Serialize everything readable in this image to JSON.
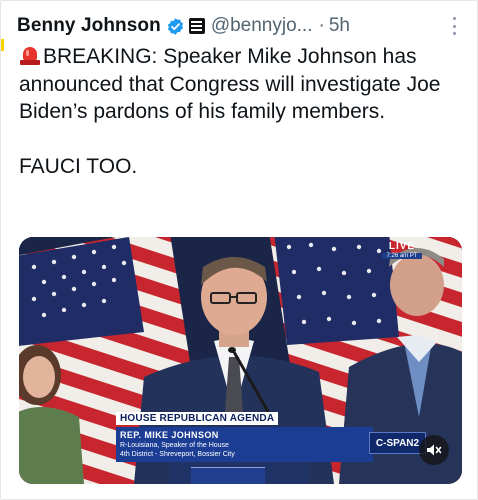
{
  "post": {
    "author": {
      "display_name": "Benny Johnson",
      "handle": "@bennyjo...",
      "verified_icon": "verified-badge-icon",
      "affiliate_icon": "org-affiliate-badge-icon"
    },
    "separator": "·",
    "time": "5h",
    "more_icon": "more-vertical-icon",
    "text": {
      "siren_icon": "police-siren-emoji",
      "line1": "BREAKING: Speaker Mike Johnson has announced that Congress will investigate Joe Biden’s pardons of his family members.",
      "line2": "FAUCI TOO."
    },
    "media": {
      "type": "video",
      "live_label": "LIVE",
      "live_time": "7:26 am PT",
      "chyron": {
        "title": "HOUSE REPUBLICAN AGENDA",
        "name": "REP. MIKE JOHNSON",
        "role": "R-Louisiana, Speaker of the House",
        "district": "4th District - Shreveport, Bossier City"
      },
      "network_logo": "C-SPAN2",
      "mute_icon": "speaker-muted-icon"
    }
  },
  "colors": {
    "text": "#0f1419",
    "secondary": "#536471",
    "verified": "#1d9bf0",
    "chyron_blue": "#1c3d94"
  }
}
